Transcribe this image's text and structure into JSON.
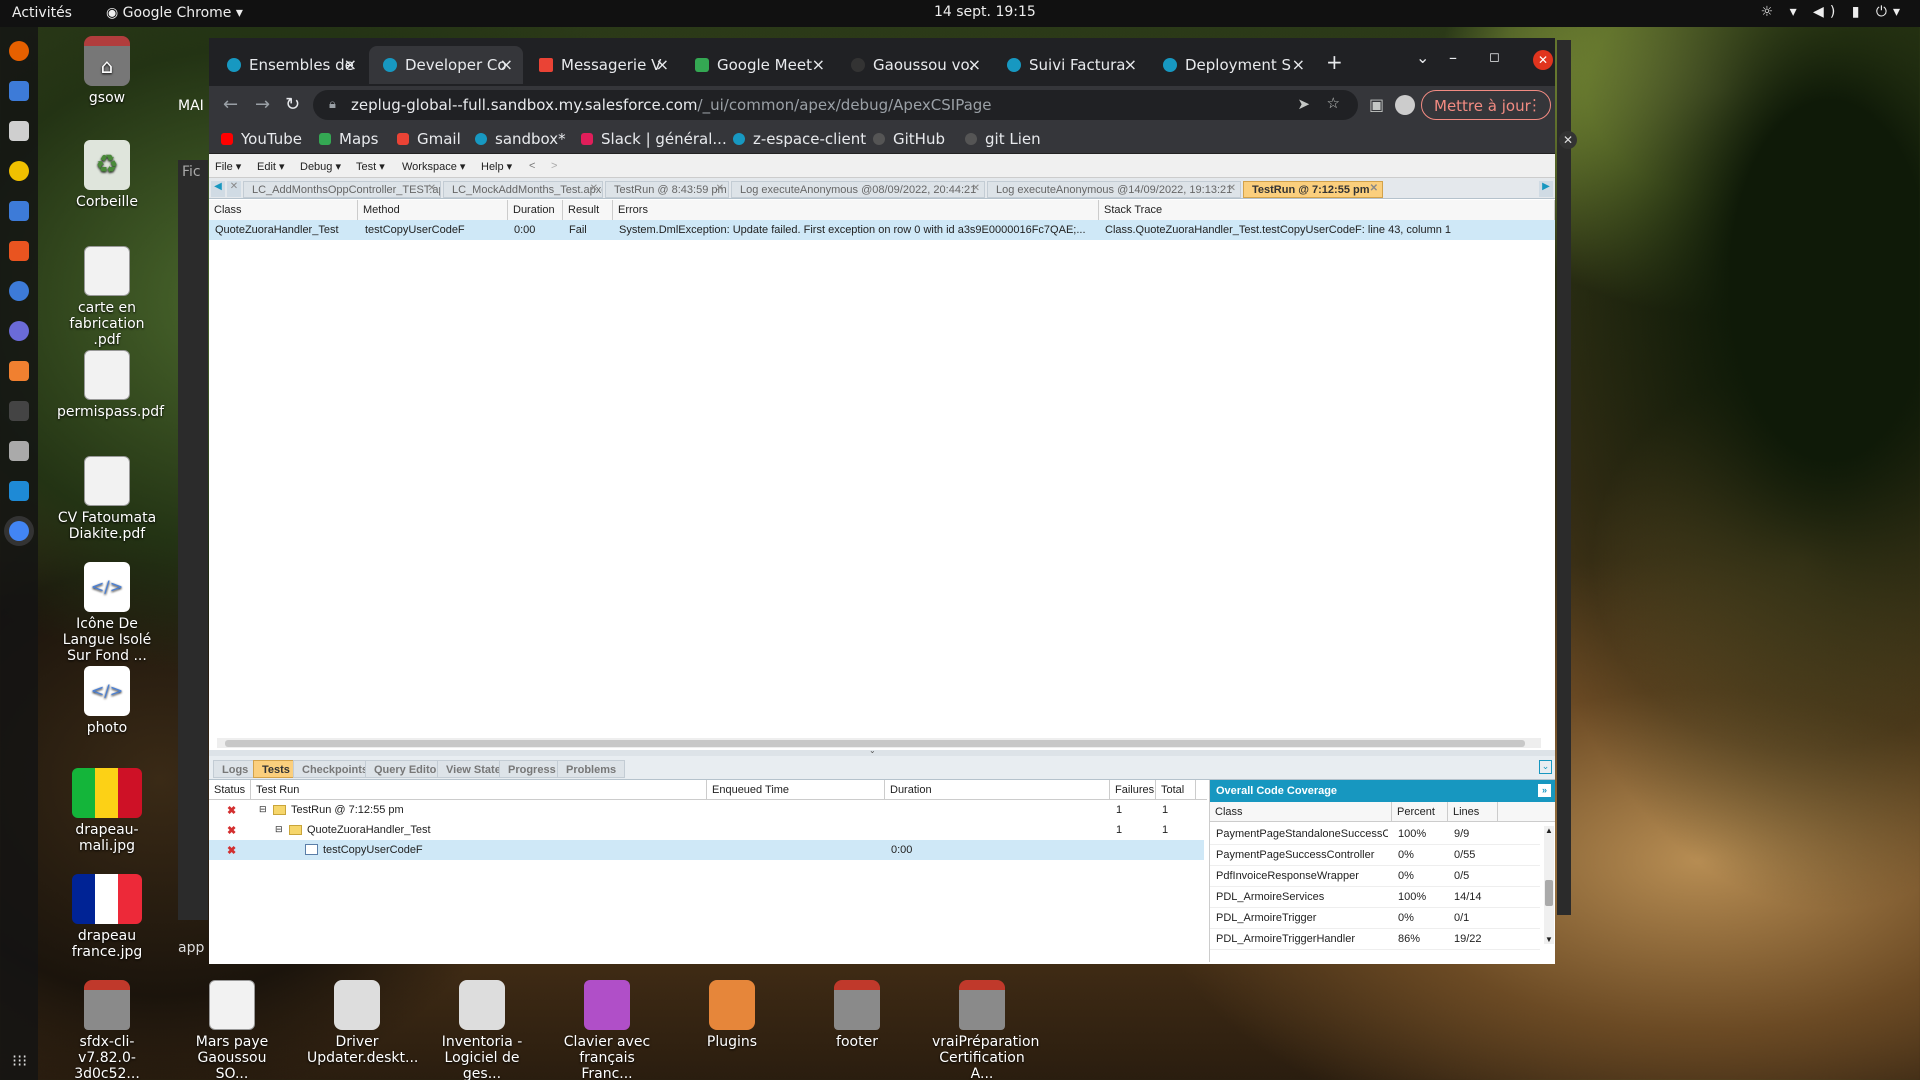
{
  "topbar": {
    "activities": "Activités",
    "app": "Google Chrome",
    "app_chevron": "▾",
    "clock": "14 sept.  19:15",
    "tray_icons": "☼ ▾ ◀) ▮ ⏻▾"
  },
  "desktop_icons": [
    {
      "label": "gsow",
      "icon": "home-folder"
    },
    {
      "label": "Corbeille",
      "icon": "trash"
    },
    {
      "label": "carte en fabrication .pdf",
      "icon": "pdf"
    },
    {
      "label": "permispass.pdf",
      "icon": "pdf"
    },
    {
      "label": "CV Fatoumata Diakite.pdf",
      "icon": "pdf"
    },
    {
      "label": "Icône De Langue Isolé Sur Fond ...",
      "icon": "code"
    },
    {
      "label": "photo",
      "icon": "code"
    },
    {
      "label": "drapeau-mali.jpg",
      "icon": "flag-mali"
    },
    {
      "label": "drapeau france.jpg",
      "icon": "flag-france"
    },
    {
      "label": "sfdx-cli-v7.82.0-3d0c52...",
      "icon": "folder"
    },
    {
      "label": "Mars paye Gaoussou SO...",
      "icon": "doc"
    },
    {
      "label": "Driver Updater.deskt...",
      "icon": "gear"
    },
    {
      "label": "Inventoria - Logiciel de ges...",
      "icon": "gear"
    },
    {
      "label": "Clavier avec français Franc...",
      "icon": "image"
    },
    {
      "label": "Plugins",
      "icon": "plugin"
    },
    {
      "label": "footer",
      "icon": "folder"
    },
    {
      "label": "vraiPréparation Certification A...",
      "icon": "folder"
    }
  ],
  "behind_window": {
    "label_mai": "MAI",
    "label_fic": "Fic",
    "label_app": "app"
  },
  "chrome": {
    "tabs": [
      {
        "label": "Ensembles de"
      },
      {
        "label": "Developer Co",
        "active": true
      },
      {
        "label": "Messagerie V"
      },
      {
        "label": "Google Meet"
      },
      {
        "label": "Gaoussou vo."
      },
      {
        "label": "Suivi Factura"
      },
      {
        "label": "Deployment S"
      }
    ],
    "tab_close": "×",
    "new_tab": "+",
    "url_host": "zeplug-global--full.sandbox.my.salesforce.com",
    "url_path": "/_ui/common/apex/debug/ApexCSIPage",
    "update_button": "Mettre à jour",
    "bookmarks": [
      "YouTube",
      "Maps",
      "Gmail",
      "sandbox*",
      "Slack | général...",
      "z-espace-client",
      "GitHub",
      "git Lien"
    ]
  },
  "dev_console": {
    "menu": [
      "File ▾",
      "Edit ▾",
      "Debug ▾",
      "Test ▾",
      "Workspace ▾",
      "Help ▾",
      "<",
      ">"
    ],
    "file_tabs": [
      {
        "label": "LC_AddMonthsOppController_TEST.apxc"
      },
      {
        "label": "LC_MockAddMonths_Test.apxc"
      },
      {
        "label": "TestRun @ 8:43:59 pm"
      },
      {
        "label": "Log executeAnonymous @08/09/2022, 20:44:21"
      },
      {
        "label": "Log executeAnonymous @14/09/2022, 19:13:21"
      },
      {
        "label": "TestRun @ 7:12:55 pm",
        "active": true
      }
    ],
    "result_headers": [
      "Class",
      "Method",
      "Duration",
      "Result",
      "Errors",
      "Stack Trace"
    ],
    "result_row": {
      "class": "QuoteZuoraHandler_Test",
      "method": "testCopyUserCodeF",
      "duration": "0:00",
      "result": "Fail",
      "errors": "System.DmlException: Update failed. First exception on row 0 with id a3s9E0000016Fc7QAE;...",
      "stack_trace": "Class.QuoteZuoraHandler_Test.testCopyUserCodeF: line 43, column 1"
    },
    "panel_tabs": [
      "Logs",
      "Tests",
      "Checkpoints",
      "Query Editor",
      "View State",
      "Progress",
      "Problems"
    ],
    "test_headers": [
      "Status",
      "Test Run",
      "Enqueued Time",
      "Duration",
      "Failures",
      "Total"
    ],
    "test_rows": [
      {
        "name": "TestRun @ 7:12:55 pm",
        "duration": "",
        "failures": "1",
        "total": "1"
      },
      {
        "name": "QuoteZuoraHandler_Test",
        "duration": "",
        "failures": "1",
        "total": "1"
      },
      {
        "name": "testCopyUserCodeF",
        "duration": "0:00",
        "failures": "",
        "total": ""
      }
    ],
    "coverage": {
      "title": "Overall Code Coverage",
      "headers": [
        "Class",
        "Percent",
        "Lines"
      ],
      "rows": [
        {
          "class": "PaymentPageStandaloneSuccessContro...",
          "percent": "100%",
          "lines": "9/9"
        },
        {
          "class": "PaymentPageSuccessController",
          "percent": "0%",
          "lines": "0/55"
        },
        {
          "class": "PdfInvoiceResponseWrapper",
          "percent": "0%",
          "lines": "0/5"
        },
        {
          "class": "PDL_ArmoireServices",
          "percent": "100%",
          "lines": "14/14"
        },
        {
          "class": "PDL_ArmoireTrigger",
          "percent": "0%",
          "lines": "0/1"
        },
        {
          "class": "PDL_ArmoireTriggerHandler",
          "percent": "86%",
          "lines": "19/22"
        }
      ]
    }
  },
  "colors": {
    "accent": "#1797c0",
    "active_tab": "#fbcf7d",
    "fail": "#d32f2f",
    "chrome_update": "#f28b82"
  }
}
